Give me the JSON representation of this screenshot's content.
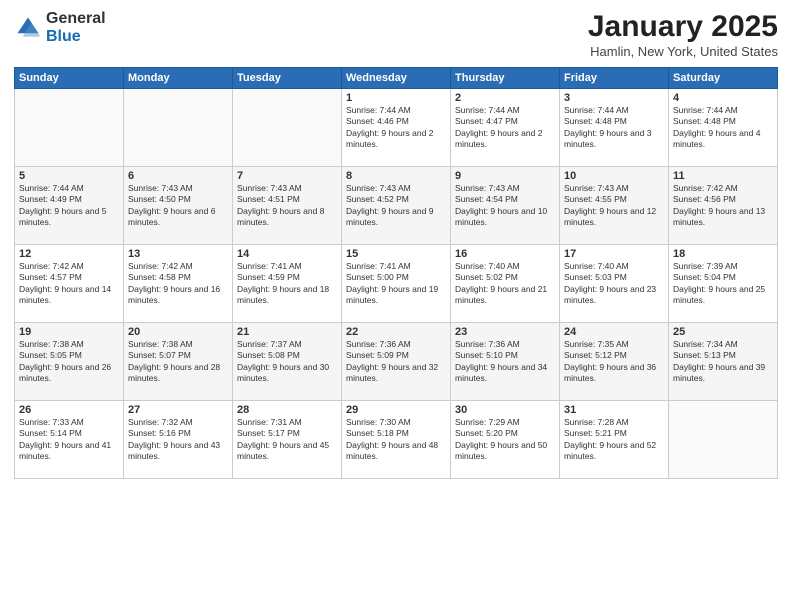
{
  "logo": {
    "general": "General",
    "blue": "Blue"
  },
  "header": {
    "month": "January 2025",
    "location": "Hamlin, New York, United States"
  },
  "weekdays": [
    "Sunday",
    "Monday",
    "Tuesday",
    "Wednesday",
    "Thursday",
    "Friday",
    "Saturday"
  ],
  "weeks": [
    [
      {
        "day": "",
        "sunrise": "",
        "sunset": "",
        "daylight": ""
      },
      {
        "day": "",
        "sunrise": "",
        "sunset": "",
        "daylight": ""
      },
      {
        "day": "",
        "sunrise": "",
        "sunset": "",
        "daylight": ""
      },
      {
        "day": "1",
        "sunrise": "Sunrise: 7:44 AM",
        "sunset": "Sunset: 4:46 PM",
        "daylight": "Daylight: 9 hours and 2 minutes."
      },
      {
        "day": "2",
        "sunrise": "Sunrise: 7:44 AM",
        "sunset": "Sunset: 4:47 PM",
        "daylight": "Daylight: 9 hours and 2 minutes."
      },
      {
        "day": "3",
        "sunrise": "Sunrise: 7:44 AM",
        "sunset": "Sunset: 4:48 PM",
        "daylight": "Daylight: 9 hours and 3 minutes."
      },
      {
        "day": "4",
        "sunrise": "Sunrise: 7:44 AM",
        "sunset": "Sunset: 4:48 PM",
        "daylight": "Daylight: 9 hours and 4 minutes."
      }
    ],
    [
      {
        "day": "5",
        "sunrise": "Sunrise: 7:44 AM",
        "sunset": "Sunset: 4:49 PM",
        "daylight": "Daylight: 9 hours and 5 minutes."
      },
      {
        "day": "6",
        "sunrise": "Sunrise: 7:43 AM",
        "sunset": "Sunset: 4:50 PM",
        "daylight": "Daylight: 9 hours and 6 minutes."
      },
      {
        "day": "7",
        "sunrise": "Sunrise: 7:43 AM",
        "sunset": "Sunset: 4:51 PM",
        "daylight": "Daylight: 9 hours and 8 minutes."
      },
      {
        "day": "8",
        "sunrise": "Sunrise: 7:43 AM",
        "sunset": "Sunset: 4:52 PM",
        "daylight": "Daylight: 9 hours and 9 minutes."
      },
      {
        "day": "9",
        "sunrise": "Sunrise: 7:43 AM",
        "sunset": "Sunset: 4:54 PM",
        "daylight": "Daylight: 9 hours and 10 minutes."
      },
      {
        "day": "10",
        "sunrise": "Sunrise: 7:43 AM",
        "sunset": "Sunset: 4:55 PM",
        "daylight": "Daylight: 9 hours and 12 minutes."
      },
      {
        "day": "11",
        "sunrise": "Sunrise: 7:42 AM",
        "sunset": "Sunset: 4:56 PM",
        "daylight": "Daylight: 9 hours and 13 minutes."
      }
    ],
    [
      {
        "day": "12",
        "sunrise": "Sunrise: 7:42 AM",
        "sunset": "Sunset: 4:57 PM",
        "daylight": "Daylight: 9 hours and 14 minutes."
      },
      {
        "day": "13",
        "sunrise": "Sunrise: 7:42 AM",
        "sunset": "Sunset: 4:58 PM",
        "daylight": "Daylight: 9 hours and 16 minutes."
      },
      {
        "day": "14",
        "sunrise": "Sunrise: 7:41 AM",
        "sunset": "Sunset: 4:59 PM",
        "daylight": "Daylight: 9 hours and 18 minutes."
      },
      {
        "day": "15",
        "sunrise": "Sunrise: 7:41 AM",
        "sunset": "Sunset: 5:00 PM",
        "daylight": "Daylight: 9 hours and 19 minutes."
      },
      {
        "day": "16",
        "sunrise": "Sunrise: 7:40 AM",
        "sunset": "Sunset: 5:02 PM",
        "daylight": "Daylight: 9 hours and 21 minutes."
      },
      {
        "day": "17",
        "sunrise": "Sunrise: 7:40 AM",
        "sunset": "Sunset: 5:03 PM",
        "daylight": "Daylight: 9 hours and 23 minutes."
      },
      {
        "day": "18",
        "sunrise": "Sunrise: 7:39 AM",
        "sunset": "Sunset: 5:04 PM",
        "daylight": "Daylight: 9 hours and 25 minutes."
      }
    ],
    [
      {
        "day": "19",
        "sunrise": "Sunrise: 7:38 AM",
        "sunset": "Sunset: 5:05 PM",
        "daylight": "Daylight: 9 hours and 26 minutes."
      },
      {
        "day": "20",
        "sunrise": "Sunrise: 7:38 AM",
        "sunset": "Sunset: 5:07 PM",
        "daylight": "Daylight: 9 hours and 28 minutes."
      },
      {
        "day": "21",
        "sunrise": "Sunrise: 7:37 AM",
        "sunset": "Sunset: 5:08 PM",
        "daylight": "Daylight: 9 hours and 30 minutes."
      },
      {
        "day": "22",
        "sunrise": "Sunrise: 7:36 AM",
        "sunset": "Sunset: 5:09 PM",
        "daylight": "Daylight: 9 hours and 32 minutes."
      },
      {
        "day": "23",
        "sunrise": "Sunrise: 7:36 AM",
        "sunset": "Sunset: 5:10 PM",
        "daylight": "Daylight: 9 hours and 34 minutes."
      },
      {
        "day": "24",
        "sunrise": "Sunrise: 7:35 AM",
        "sunset": "Sunset: 5:12 PM",
        "daylight": "Daylight: 9 hours and 36 minutes."
      },
      {
        "day": "25",
        "sunrise": "Sunrise: 7:34 AM",
        "sunset": "Sunset: 5:13 PM",
        "daylight": "Daylight: 9 hours and 39 minutes."
      }
    ],
    [
      {
        "day": "26",
        "sunrise": "Sunrise: 7:33 AM",
        "sunset": "Sunset: 5:14 PM",
        "daylight": "Daylight: 9 hours and 41 minutes."
      },
      {
        "day": "27",
        "sunrise": "Sunrise: 7:32 AM",
        "sunset": "Sunset: 5:16 PM",
        "daylight": "Daylight: 9 hours and 43 minutes."
      },
      {
        "day": "28",
        "sunrise": "Sunrise: 7:31 AM",
        "sunset": "Sunset: 5:17 PM",
        "daylight": "Daylight: 9 hours and 45 minutes."
      },
      {
        "day": "29",
        "sunrise": "Sunrise: 7:30 AM",
        "sunset": "Sunset: 5:18 PM",
        "daylight": "Daylight: 9 hours and 48 minutes."
      },
      {
        "day": "30",
        "sunrise": "Sunrise: 7:29 AM",
        "sunset": "Sunset: 5:20 PM",
        "daylight": "Daylight: 9 hours and 50 minutes."
      },
      {
        "day": "31",
        "sunrise": "Sunrise: 7:28 AM",
        "sunset": "Sunset: 5:21 PM",
        "daylight": "Daylight: 9 hours and 52 minutes."
      },
      {
        "day": "",
        "sunrise": "",
        "sunset": "",
        "daylight": ""
      }
    ]
  ]
}
